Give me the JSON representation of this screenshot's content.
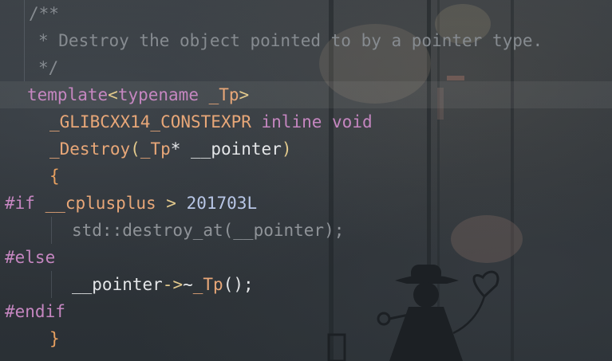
{
  "lines": [
    {
      "tokens": [
        {
          "t": "/**",
          "c": "comment"
        }
      ]
    },
    {
      "tokens": [
        {
          "t": "* Destroy the object pointed to by a pointer type.",
          "c": "comment"
        }
      ]
    },
    {
      "tokens": [
        {
          "t": "*/",
          "c": "comment"
        }
      ]
    },
    {
      "tokens": [
        {
          "t": "template",
          "c": "kw"
        },
        {
          "t": "<",
          "c": "punct"
        },
        {
          "t": "typename",
          "c": "kw"
        },
        {
          "t": " _Tp",
          "c": "type"
        },
        {
          "t": ">",
          "c": "punct"
        }
      ]
    },
    {
      "tokens": [
        {
          "t": "_GLIBCXX14_CONSTEXPR",
          "c": "macro"
        },
        {
          "t": " inline",
          "c": "kw"
        },
        {
          "t": " void",
          "c": "kw"
        }
      ]
    },
    {
      "tokens": [
        {
          "t": "_Destroy",
          "c": "fn"
        },
        {
          "t": "(",
          "c": "punct"
        },
        {
          "t": "_Tp",
          "c": "type"
        },
        {
          "t": "* ",
          "c": "ident"
        },
        {
          "t": "__pointer",
          "c": "ident"
        },
        {
          "t": ")",
          "c": "punct"
        }
      ]
    },
    {
      "tokens": [
        {
          "t": "{",
          "c": "brace"
        }
      ]
    },
    {
      "tokens": [
        {
          "t": "#if",
          "c": "kw"
        },
        {
          "t": " __cplusplus",
          "c": "macro"
        },
        {
          "t": " > ",
          "c": "punct"
        },
        {
          "t": "201703L",
          "c": "num"
        }
      ]
    },
    {
      "tokens": [
        {
          "t": "std::destroy_at(__pointer);",
          "c": "dim"
        }
      ]
    },
    {
      "tokens": [
        {
          "t": "#else",
          "c": "kw"
        }
      ]
    },
    {
      "tokens": [
        {
          "t": "__pointer",
          "c": "ident"
        },
        {
          "t": "->",
          "c": "punct"
        },
        {
          "t": "~",
          "c": "ident"
        },
        {
          "t": "_Tp",
          "c": "type"
        },
        {
          "t": "();",
          "c": "ident"
        }
      ]
    },
    {
      "tokens": [
        {
          "t": "#endif",
          "c": "kw"
        }
      ]
    },
    {
      "tokens": [
        {
          "t": "}",
          "c": "brace"
        }
      ]
    }
  ]
}
